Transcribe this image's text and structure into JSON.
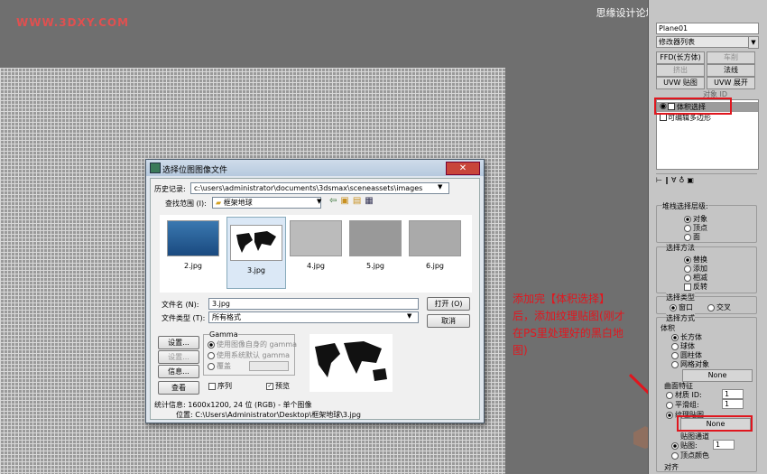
{
  "watermark_left": "WWW.3DXY.COM",
  "watermark_right": "思缘设计论坛 www.MISSYUAN.COM",
  "panel": {
    "object_name": "Plane01",
    "modifier_list": "修改器列表",
    "buttons": [
      [
        "FFD(长方体)",
        "车削"
      ],
      [
        "挤出",
        "法线"
      ],
      [
        "UVW 贴图",
        "UVW 展开"
      ]
    ],
    "disabled": [
      "车削",
      "挤出"
    ],
    "edge_label": "对象 ID",
    "stack": [
      "体积选择",
      "可编辑多边形"
    ],
    "stack_group": "堆栈选择层级:",
    "level_opts": [
      "对象",
      "顶点",
      "面"
    ],
    "select_method": "选择方法",
    "method_opts": [
      "替换",
      "添加",
      "相减",
      "反转"
    ],
    "select_type": "选择类型",
    "type_opts": [
      "窗口",
      "交叉"
    ],
    "select_style": "选择方式",
    "volume": "体积",
    "volume_opts": [
      "长方体",
      "球体",
      "圆柱体",
      "网格对象"
    ],
    "none1": "None",
    "surface": "曲面特征",
    "surf_opts": [
      "材质 ID:",
      "平滑组:",
      "纹理贴图"
    ],
    "id_val": "1",
    "sm_val": "1",
    "none2": "None",
    "map_channel": "贴图通道",
    "map_opts": [
      "贴图:",
      "顶点颜色"
    ],
    "map_val": "1",
    "align": "对齐"
  },
  "dialog": {
    "title": "选择位图图像文件",
    "history_label": "历史记录:",
    "history_value": "c:\\users\\administrator\\documents\\3dsmax\\sceneassets\\images",
    "lookin_label": "查找范围 (I):",
    "lookin_value": "框架地球",
    "thumbs": [
      "2.jpg",
      "3.jpg",
      "4.jpg",
      "5.jpg",
      "6.jpg"
    ],
    "filename_label": "文件名 (N):",
    "filename_value": "3.jpg",
    "filetype_label": "文件类型 (T):",
    "filetype_value": "所有格式",
    "open": "打开 (O)",
    "cancel": "取消",
    "setup": "设置...",
    "info": "信息...",
    "view": "查看",
    "setup2": "设置...",
    "gamma_title": "Gamma",
    "gamma_opts": [
      "使用图像自身的 gamma",
      "使用系统默认 gamma",
      "覆盖"
    ],
    "sequence": "序列",
    "preview": "预览",
    "stats": "统计信息: 1600x1200, 24 位 (RGB) - 单个图像",
    "location": "位置: C:\\Users\\Administrator\\Desktop\\框架地球\\3.jpg"
  },
  "note": "添加完【体积选择】后，添加纹理贴图(刚才在PS里处理好的黑白地图)"
}
